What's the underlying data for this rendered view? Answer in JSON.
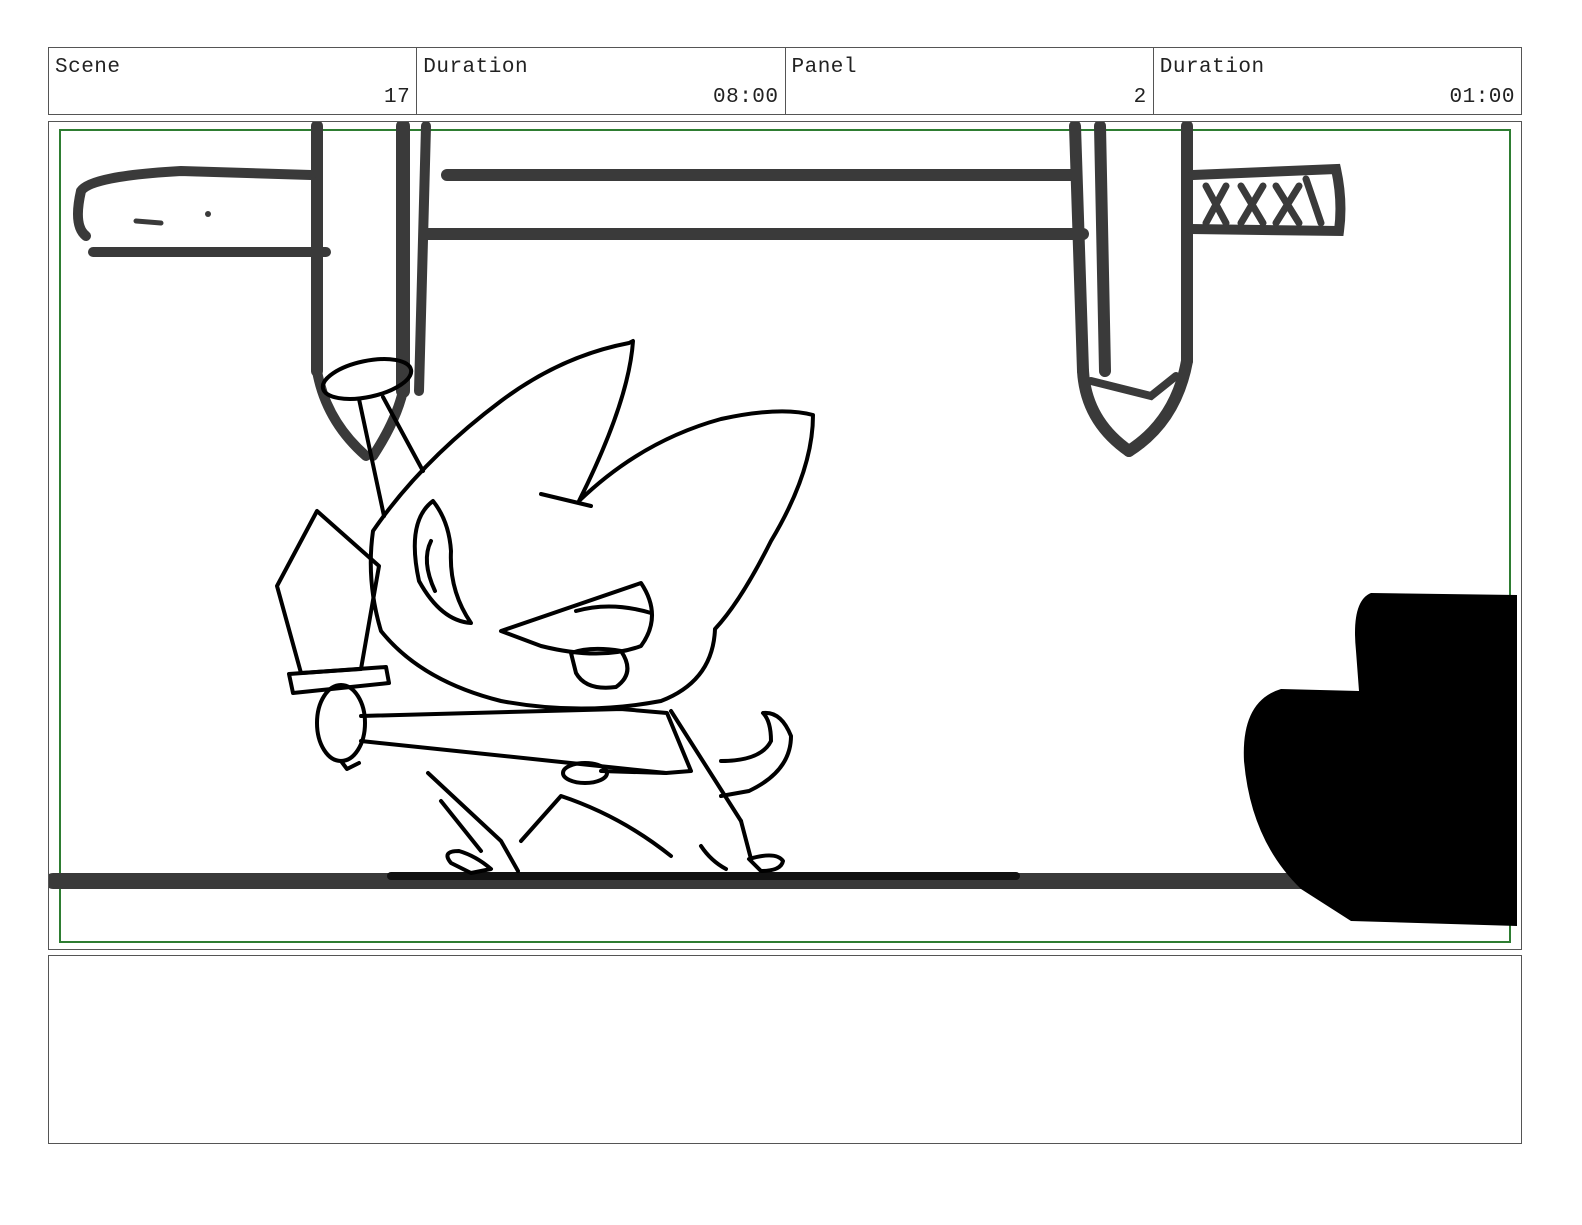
{
  "header": {
    "scene_label": "Scene",
    "scene_value": "17",
    "scene_duration_label": "Duration",
    "scene_duration_value": "08:00",
    "panel_label": "Panel",
    "panel_value": "2",
    "panel_duration_label": "Duration",
    "panel_duration_value": "01:00"
  },
  "colors": {
    "safe_area": "#2e7d32",
    "ink": "#000000",
    "dark_ink": "#3a3a3a"
  },
  "icons": [
    "cat-character-sketch",
    "wooden-sword-sketch",
    "foreground-silhouette"
  ],
  "notes": {
    "text": ""
  }
}
